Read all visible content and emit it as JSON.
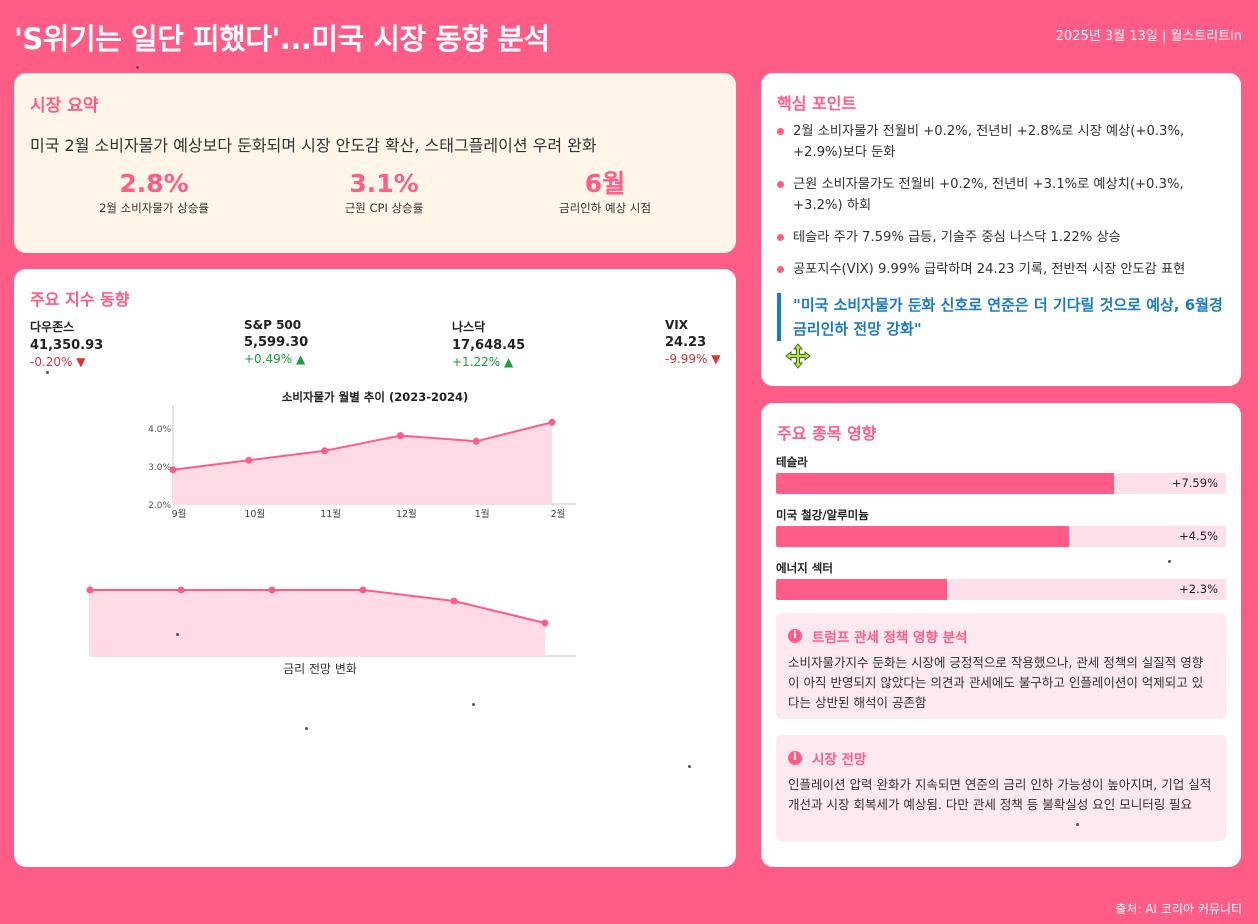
{
  "header": {
    "title": "'S위기는 일단 피했다'...미국 시장 동향 분석",
    "date_source": "2025년 3월 13일 | 월스트리트in"
  },
  "summary": {
    "title": "시장 요약",
    "headline": "미국 2월 소비자물가 예상보다 둔화되며 시장 안도감 확산, 스태그플레이션 우려 완화",
    "stats": [
      {
        "value": "2.8%",
        "label": "2월 소비자물가 상승률"
      },
      {
        "value": "3.1%",
        "label": "근원 CPI 상승률"
      },
      {
        "value": "6월",
        "label": "금리인하 예상 시점"
      }
    ]
  },
  "indices": {
    "title": "주요 지수 동향",
    "items": [
      {
        "name": "다우존스",
        "price": "41,350.93",
        "change": "-0.20% ▼",
        "direction": "down"
      },
      {
        "name": "S&P 500",
        "price": "5,599.30",
        "change": "+0.49% ▲",
        "direction": "up"
      },
      {
        "name": "나스닥",
        "price": "17,648.45",
        "change": "+1.22% ▲",
        "direction": "up"
      },
      {
        "name": "VIX",
        "price": "24.23",
        "change": "-9.99% ▼",
        "direction": "down"
      }
    ]
  },
  "chart_data": [
    {
      "type": "area",
      "title": "소비자물가 월별 추이 (2023-2024)",
      "categories": [
        "9월",
        "10월",
        "11월",
        "12월",
        "1월",
        "2월"
      ],
      "values": [
        2.9,
        3.15,
        3.4,
        3.8,
        3.65,
        4.15
      ],
      "yticks": [
        "2.0%",
        "3.0%",
        "4.0%"
      ],
      "ylim": [
        2.0,
        4.5
      ],
      "color": "#ff5c88",
      "fill": "#ffdbe6"
    },
    {
      "type": "area",
      "title": "",
      "xlabel": "금리 전망 변화",
      "values": [
        5.5,
        5.5,
        5.5,
        5.5,
        5.25,
        4.75
      ],
      "ylim": [
        4.0,
        5.75
      ],
      "color": "#ff5c88",
      "fill": "#ffdbe6"
    }
  ],
  "key_points": {
    "title": "핵심 포인트",
    "items": [
      "2월 소비자물가 전월비 +0.2%, 전년비 +2.8%로 시장 예상(+0.3%, +2.9%)보다 둔화",
      "근원 소비자물가도 전월비 +0.2%, 전년비 +3.1%로 예상치(+0.3%, +3.2%) 하회",
      "테슬라 주가 7.59% 급등, 기술주 중심 나스닥 1.22% 상승",
      "공포지수(VIX) 9.99% 급락하며 24.23 기록, 전반적 시장 안도감 표현"
    ],
    "quote": "\"미국 소비자물가 둔화 신호로 연준은 더 기다릴 것으로 예상, 6월경 금리인하 전망 강화\""
  },
  "stocks": {
    "title": "주요 종목 영향",
    "items": [
      {
        "name": "테슬라",
        "value": "+7.59%",
        "fill": 0.75
      },
      {
        "name": "미국 철강/알루미늄",
        "value": "+4.5%",
        "fill": 0.65
      },
      {
        "name": "에너지 섹터",
        "value": "+2.3%",
        "fill": 0.38
      }
    ],
    "notes": [
      {
        "title": "트럼프 관세 정책 영향 분석",
        "body": "소비자물가지수 둔화는 시장에 긍정적으로 작용했으나, 관세 정책의 실질적 영향이 아직 반영되지 않았다는 의견과 관세에도 불구하고 인플레이션이 억제되고 있다는 상반된 해석이 공존함"
      },
      {
        "title": "시장 전망",
        "body": "인플레이션 압력 완화가 지속되면 연준의 금리 인하 가능성이 높아지며, 기업 실적 개선과 시장 회복세가 예상됨. 다만 관세 정책 등 불확실성 요인 모니터링 필요"
      }
    ]
  },
  "footer": "출처: AI 코리아 커뮤니티",
  "icons": {
    "info": "info-icon",
    "move": "move-cursor-icon"
  }
}
